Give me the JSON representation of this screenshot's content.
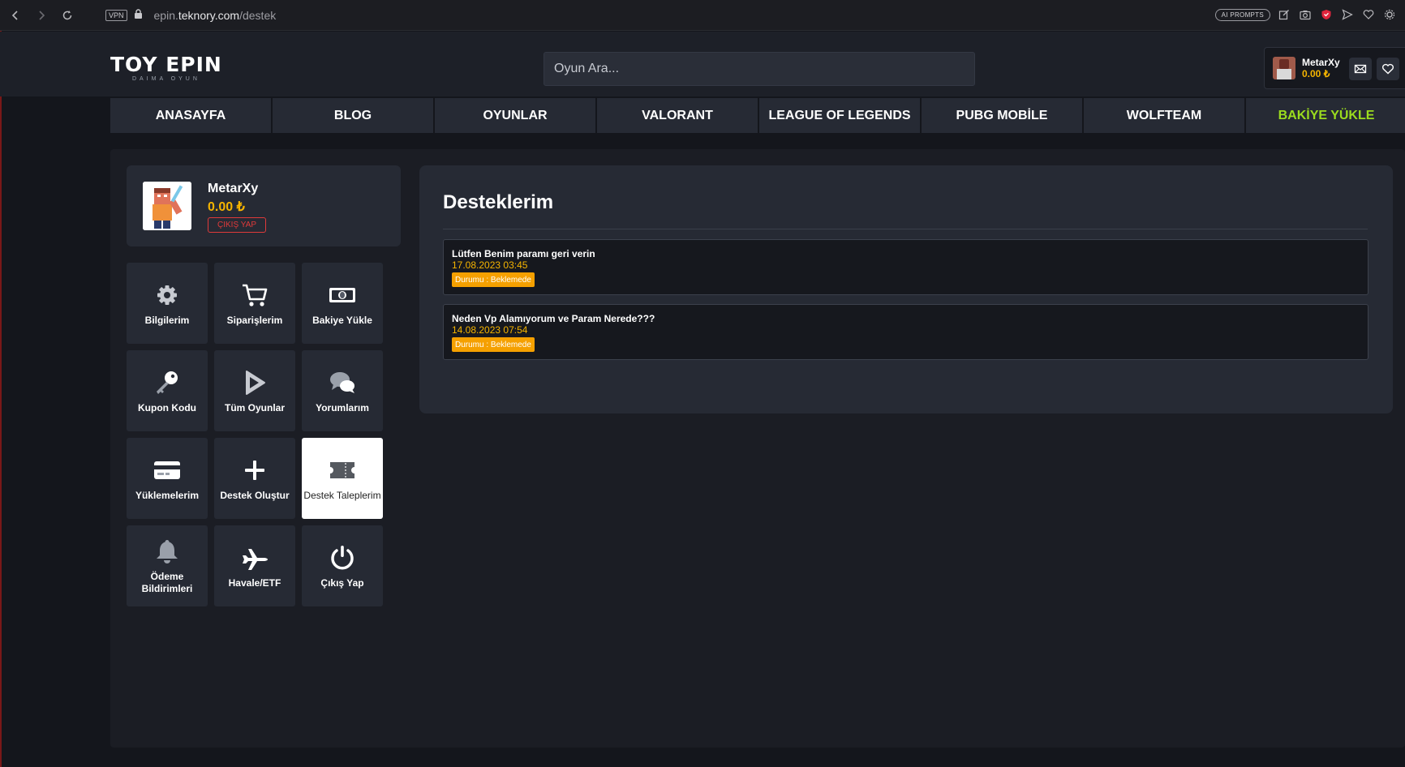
{
  "browser": {
    "vpn_label": "VPN",
    "url_prefix": "epin.",
    "url_domain": "teknory.com",
    "url_path": "/destek",
    "ai_prompts_label": "AI PROMPTS"
  },
  "header": {
    "logo_main": "TOY EPIN",
    "logo_sub": "DAIMA OYUN",
    "search_placeholder": "Oyun Ara...",
    "user_name": "MetarXy",
    "user_balance": "0.00 ₺"
  },
  "nav": {
    "items": [
      "ANASAYFA",
      "BLOG",
      "OYUNLAR",
      "VALORANT",
      "LEAGUE OF LEGENDS",
      "PUBG MOBİLE",
      "WOLFTEAM",
      "BAKİYE YÜKLE"
    ],
    "accent_color": "#9bdc1e"
  },
  "profile": {
    "name": "MetarXy",
    "balance": "0.00 ₺",
    "logout_label": "ÇIKIŞ YAP"
  },
  "menu": {
    "tiles": [
      {
        "label": "Bilgilerim",
        "icon": "gear-icon"
      },
      {
        "label": "Siparişlerim",
        "icon": "cart-icon"
      },
      {
        "label": "Bakiye Yükle",
        "icon": "money-icon"
      },
      {
        "label": "Kupon Kodu",
        "icon": "key-icon"
      },
      {
        "label": "Tüm Oyunlar",
        "icon": "play-icon"
      },
      {
        "label": "Yorumlarım",
        "icon": "comments-icon"
      },
      {
        "label": "Yüklemelerim",
        "icon": "credit-card-icon"
      },
      {
        "label": "Destek Oluştur",
        "icon": "plus-icon"
      },
      {
        "label": "Destek Taleplerim",
        "icon": "ticket-icon",
        "active": true
      },
      {
        "label": "Ödeme Bildirimleri",
        "icon": "bell-icon"
      },
      {
        "label": "Havale/ETF",
        "icon": "plane-icon"
      },
      {
        "label": "Çıkış Yap",
        "icon": "power-icon"
      }
    ]
  },
  "support": {
    "title": "Desteklerim",
    "tickets": [
      {
        "title": "Lütfen Benim paramı geri verin",
        "date": "17.08.2023 03:45",
        "status": "Durumu : Beklemede"
      },
      {
        "title": "Neden Vp Alamıyorum ve Param Nerede???",
        "date": "14.08.2023 07:54",
        "status": "Durumu : Beklemede"
      }
    ]
  },
  "colors": {
    "balance": "#f5b400",
    "status_badge": "#f5a000",
    "logout": "#e03a3a"
  }
}
